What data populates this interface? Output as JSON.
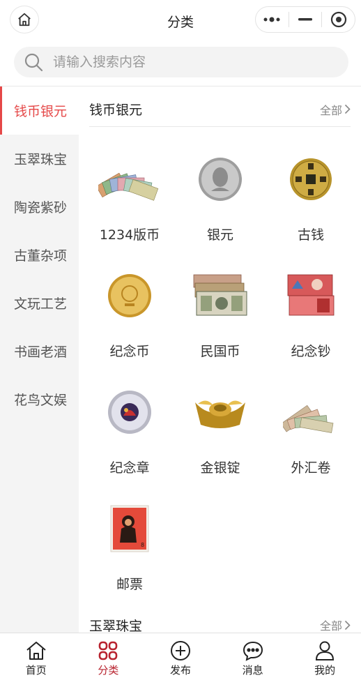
{
  "header": {
    "title": "分类",
    "home_icon": "home-icon",
    "more_icon": "more-dots-icon",
    "minimize_icon": "minimize-icon",
    "close_icon": "target-close-icon"
  },
  "search": {
    "placeholder": "请输入搜索内容",
    "icon": "search-icon"
  },
  "sidebar": {
    "items": [
      {
        "label": "钱币银元",
        "active": true
      },
      {
        "label": "玉翠珠宝"
      },
      {
        "label": "陶瓷紫砂"
      },
      {
        "label": "古董杂项"
      },
      {
        "label": "文玩工艺"
      },
      {
        "label": "书画老酒"
      },
      {
        "label": "花鸟文娱"
      }
    ]
  },
  "sections": [
    {
      "title": "钱币银元",
      "all_label": "全部",
      "items": [
        {
          "label": "1234版币",
          "image": "banknote-fan-image"
        },
        {
          "label": "银元",
          "image": "silver-coin-image"
        },
        {
          "label": "古钱",
          "image": "ancient-coin-image"
        },
        {
          "label": "纪念币",
          "image": "gold-coin-image"
        },
        {
          "label": "民国币",
          "image": "republic-banknote-image"
        },
        {
          "label": "纪念钞",
          "image": "commemorative-note-image"
        },
        {
          "label": "纪念章",
          "image": "medal-image"
        },
        {
          "label": "金银锭",
          "image": "gold-ingot-image"
        },
        {
          "label": "外汇卷",
          "image": "foreign-exchange-note-image"
        },
        {
          "label": "邮票",
          "image": "monkey-stamp-image"
        }
      ]
    },
    {
      "title": "玉翠珠宝",
      "all_label": "全部"
    }
  ],
  "tabbar": {
    "tabs": [
      {
        "label": "首页",
        "icon": "home-icon"
      },
      {
        "label": "分类",
        "icon": "category-icon",
        "active": true
      },
      {
        "label": "发布",
        "icon": "plus-circle-icon"
      },
      {
        "label": "消息",
        "icon": "chat-bubble-icon"
      },
      {
        "label": "我的",
        "icon": "user-icon"
      }
    ]
  },
  "colors": {
    "accent": "#e54848",
    "tab_active": "#b8232f",
    "sidebar_bg": "#f4f4f4"
  }
}
